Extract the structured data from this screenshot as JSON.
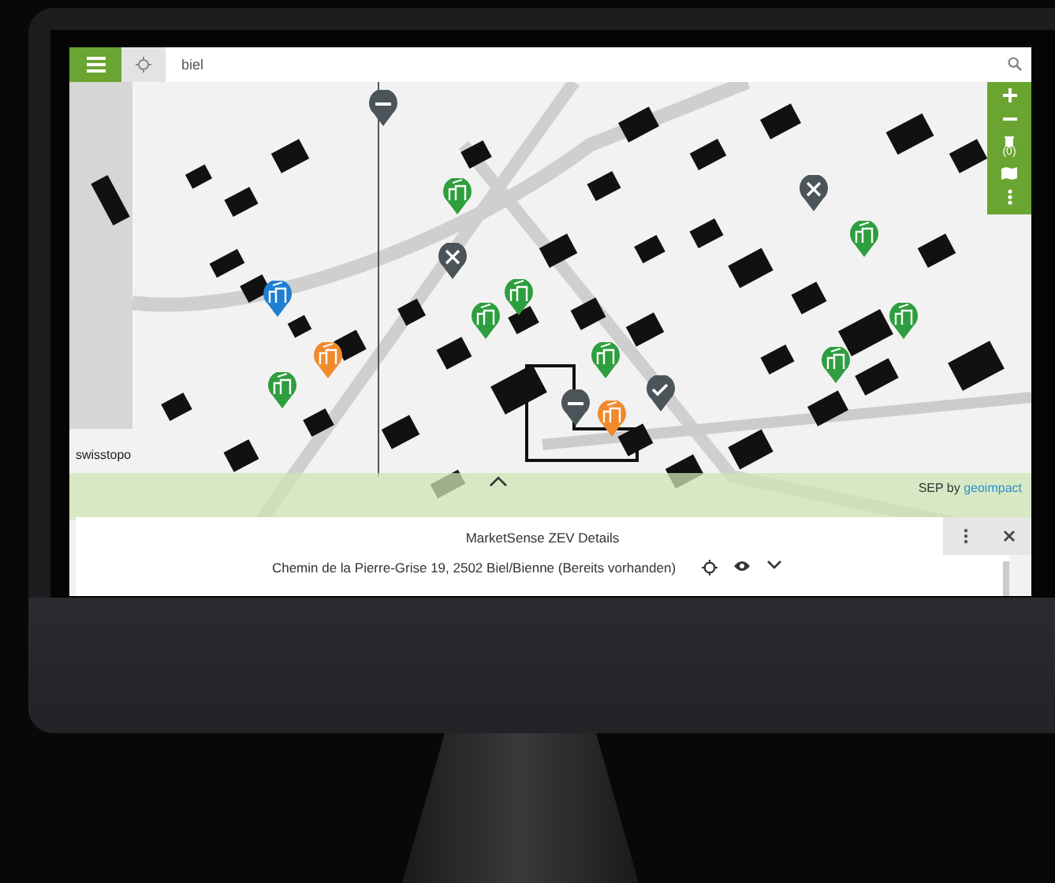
{
  "search": {
    "value": "biel"
  },
  "map": {
    "source_label": "swisstopo",
    "attribution": {
      "text": "SEP by",
      "link": "geoimpact"
    },
    "pins": [
      {
        "kind": "minus",
        "color": "#4a5459"
      },
      {
        "kind": "building",
        "color": "#2e9e3e"
      },
      {
        "kind": "cross",
        "color": "#4a5459"
      },
      {
        "kind": "building",
        "color": "#1f7fd0"
      },
      {
        "kind": "building",
        "color": "#2e9e3e"
      },
      {
        "kind": "building",
        "color": "#2e9e3e"
      },
      {
        "kind": "building",
        "color": "#f08a2c"
      },
      {
        "kind": "building",
        "color": "#2e9e3e"
      },
      {
        "kind": "building",
        "color": "#2e9e3e"
      },
      {
        "kind": "minus",
        "color": "#4a5459"
      },
      {
        "kind": "building",
        "color": "#f08a2c"
      },
      {
        "kind": "check",
        "color": "#4a5459"
      },
      {
        "kind": "cross",
        "color": "#4a5459"
      },
      {
        "kind": "building",
        "color": "#2e9e3e"
      },
      {
        "kind": "building",
        "color": "#2e9e3e"
      },
      {
        "kind": "building",
        "color": "#2e9e3e"
      }
    ]
  },
  "toolbar": {
    "basket_count": "(0)"
  },
  "details": {
    "title": "MarketSense ZEV Details",
    "rows": [
      {
        "address": "Chemin de la Pierre-Grise 19, 2502 Biel/Bienne (Bereits vorhanden)"
      }
    ]
  }
}
